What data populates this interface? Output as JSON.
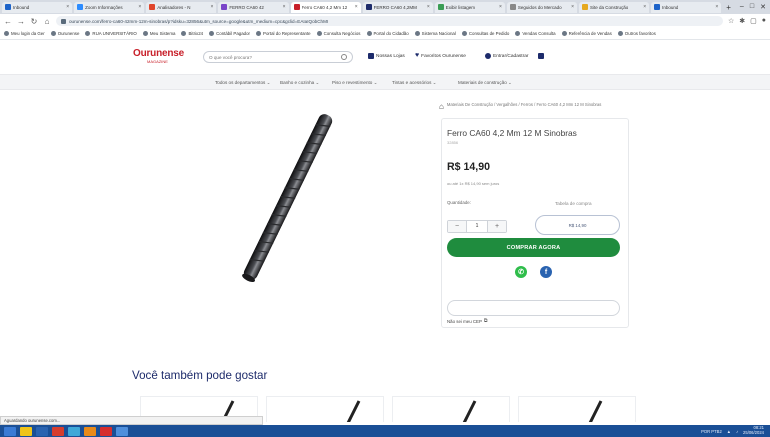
{
  "browser": {
    "tabs": [
      {
        "title": "Inbound",
        "color": "#1d63c9",
        "active": false
      },
      {
        "title": "Zoom Informações",
        "color": "#2d8cff",
        "active": false
      },
      {
        "title": "Analisadores - N",
        "color": "#e0452b",
        "active": false
      },
      {
        "title": "FERRO CA60 42",
        "color": "#7a45c9",
        "active": false
      },
      {
        "title": "Ferro CA60 4,2 Mm 12",
        "color": "#c8202a",
        "active": true
      },
      {
        "title": "FERRO CA60 4,2MM",
        "color": "#1d2b6b",
        "active": false
      },
      {
        "title": "Exibir listagem",
        "color": "#3a9d55",
        "active": false
      },
      {
        "title": "Seguidos do Mercado",
        "color": "#888888",
        "active": false
      },
      {
        "title": "Site da Construção",
        "color": "#e6a91f",
        "active": false
      },
      {
        "title": "Inbound",
        "color": "#1d63c9",
        "active": false
      }
    ],
    "new_tab": "+",
    "url": "ourunense.com/ferro-ca60-42mm-12m-sinobras/p?idsku=32856&utm_source=google&utm_medium=cpc&gclid=EAIaIQobChMI",
    "bookmarks": [
      "Meu login da Ger",
      "Ourunense",
      "RUA UNIVERSITÁRIO",
      "Meu Sistema",
      "Bitrix24",
      "Contábil Pagador",
      "Portal do Representante",
      "Consulta Negócios",
      "Portal do Cidadão",
      "Sistema Nacional",
      "Consultas de Pedido",
      "Vendas Consulta",
      "Referência de Vendas",
      "Outros favoritos"
    ]
  },
  "site": {
    "logo": "Ourunense",
    "logo_tag": "MAGAZINE",
    "search_placeholder": "O que você procura?",
    "nav_links": [
      {
        "label": "Nossas Lojas",
        "icon": "store-icon"
      },
      {
        "label": "Favoritos Ourunense",
        "icon": "heart-icon"
      },
      {
        "label": "Entrar/Cadastrar",
        "icon": "user-icon"
      },
      {
        "label": "",
        "icon": "cart-icon"
      }
    ],
    "categories": [
      "Todos os departamentos ⌄",
      "Banho e cozinha ⌄",
      "Piso e revestimento ⌄",
      "Tintas e acessórios ⌄",
      "Materiais de construção ⌄"
    ]
  },
  "product": {
    "breadcrumb": "Materiais De Construção / Vergalhões / Ferros / Ferro CA60 4,2 Mm 12 M Sinobras",
    "title": "Ferro CA60 4,2 Mm 12 M Sinobras",
    "sku": "32856",
    "price": "R$ 14,90",
    "installments": "ou até 1x R$ 14,90 sem juros",
    "quantity_label": "Quantidade:",
    "table_link": "Tabela de compra",
    "quantity": "1",
    "add_to_cart": "R$ 14,90",
    "buy_now": "COMPRAR AGORA",
    "cep_placeholder": "",
    "cep_link": "Não sei meu CEP"
  },
  "recommendations": {
    "heading": "Você também pode gostar"
  },
  "status_bar": "Aguardando ourunense.com...",
  "taskbar": {
    "icons": [
      "#3a7bd5",
      "#f0c419",
      "#2a63b0",
      "#d63d2e",
      "#3fa8d8",
      "#e88a1a",
      "#d62d2d",
      "#4f8fdc"
    ],
    "tray": "POR PTB2",
    "time": "08:21",
    "date": "25/06/2024"
  }
}
